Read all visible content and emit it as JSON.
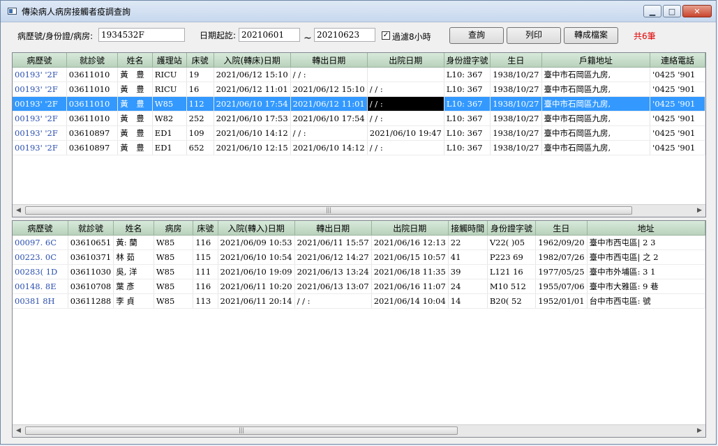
{
  "window": {
    "title": "傳染病人病房接觸者疫調查詢"
  },
  "toolbar": {
    "id_label": "病歷號/身份證/病房:",
    "id_value": "1934532F",
    "date_label": "日期起訖:",
    "date_from": "20210601",
    "tilde": "~",
    "date_to": "20210623",
    "filter_checked": "✓",
    "filter_label": "過濾8小時",
    "query_label": "查詢",
    "print_label": "列印",
    "export_label": "轉成檔案",
    "count_label": "共6筆"
  },
  "top_grid": {
    "columns": [
      "病歷號",
      "就診號",
      "姓名",
      "護理站",
      "床號",
      "入院(轉床)日期",
      "轉出日期",
      "出院日期",
      "身份證字號",
      "生日",
      "戶籍地址",
      "連絡電話"
    ],
    "rows": [
      [
        "00193'  '2F",
        "03611010",
        "黃　豊",
        "RICU",
        "19",
        "2021/06/12 15:10",
        "  / /    :",
        "",
        "L10:      367",
        "1938/10/27",
        "臺中市石岡區九房,",
        "'0425  '901"
      ],
      [
        "00193'  '2F",
        "03611010",
        "黃　豊",
        "RICU",
        "16",
        "2021/06/12 11:01",
        "2021/06/12 15:10",
        "  / /    :",
        "L10:      367",
        "1938/10/27",
        "臺中市石岡區九房,",
        "'0425  '901"
      ],
      [
        "00193'  '2F",
        "03611010",
        "黃　豊",
        "W85",
        "112",
        "2021/06/10 17:54",
        "2021/06/12 11:01",
        "  / /    :",
        "L10:      367",
        "1938/10/27",
        "臺中市石岡區九房,",
        "'0425  '901"
      ],
      [
        "00193'  '2F",
        "03611010",
        "黃　豊",
        "W82",
        "252",
        "2021/06/10 17:53",
        "2021/06/10 17:54",
        "  / /    :",
        "L10:      367",
        "1938/10/27",
        "臺中市石岡區九房,",
        "'0425  '901"
      ],
      [
        "00193'  '2F",
        "03610897",
        "黃　豊",
        "ED1",
        "109",
        "2021/06/10 14:12",
        "  / /    :",
        "2021/06/10 19:47",
        "L10:      367",
        "1938/10/27",
        "臺中市石岡區九房,",
        "'0425  '901"
      ],
      [
        "00193'  '2F",
        "03610897",
        "黃　豊",
        "ED1",
        "652",
        "2021/06/10 12:15",
        "2021/06/10 14:12",
        "  / /    :",
        "L10:      367",
        "1938/10/27",
        "臺中市石岡區九房,",
        "'0425  '901"
      ]
    ]
  },
  "bottom_grid": {
    "columns": [
      "病歷號",
      "就診號",
      "姓名",
      "病房",
      "床號",
      "入院(轉入)日期",
      "轉出日期",
      "出院日期",
      "接觸時間",
      "身份證字號",
      "生日",
      "地址"
    ],
    "rows": [
      [
        "00097.   6C",
        "03610651",
        "黃:  蘭",
        "W85",
        "116",
        "2021/06/09 10:53",
        "2021/06/11 15:57",
        "2021/06/16 12:13",
        "22",
        "V22(      )05",
        "1962/09/20",
        "臺中市西屯區|                           2 3"
      ],
      [
        "00223.   0C",
        "03610371",
        "林    茹",
        "W85",
        "115",
        "2021/06/10 10:54",
        "2021/06/12 14:27",
        "2021/06/15 10:57",
        "41",
        "P223      69",
        "1982/07/26",
        "臺中市西屯區|                           之 2"
      ],
      [
        "00283(   1D",
        "03611030",
        "吳,   洋",
        "W85",
        "111",
        "2021/06/10 19:09",
        "2021/06/13 13:24",
        "2021/06/18 11:35",
        "39",
        "L121      16",
        "1977/05/25",
        "臺中市外埔區:                          3 1"
      ],
      [
        "00148.   8E",
        "03610708",
        "葉    彥",
        "W85",
        "116",
        "2021/06/11 10:20",
        "2021/06/13 13:07",
        "2021/06/16 11:07",
        "24",
        "M10       512",
        "1955/07/06",
        "臺中市大雅區:                          9 巷"
      ],
      [
        "00381    8H",
        "03611288",
        "李    貞",
        "W85",
        "113",
        "2021/06/11 20:14",
        "  / /    :",
        "2021/06/14 10:04",
        "14",
        "B20(      52",
        "1952/01/01",
        "台中市西屯區:                          號"
      ]
    ]
  },
  "colors": {
    "selection": "#3399ff",
    "header": "#c6dcc9",
    "count": "#e00000"
  },
  "icons": {
    "app": "window-icon",
    "minimize": "minimize-icon",
    "maximize": "maximize-icon",
    "close": "close-icon"
  }
}
